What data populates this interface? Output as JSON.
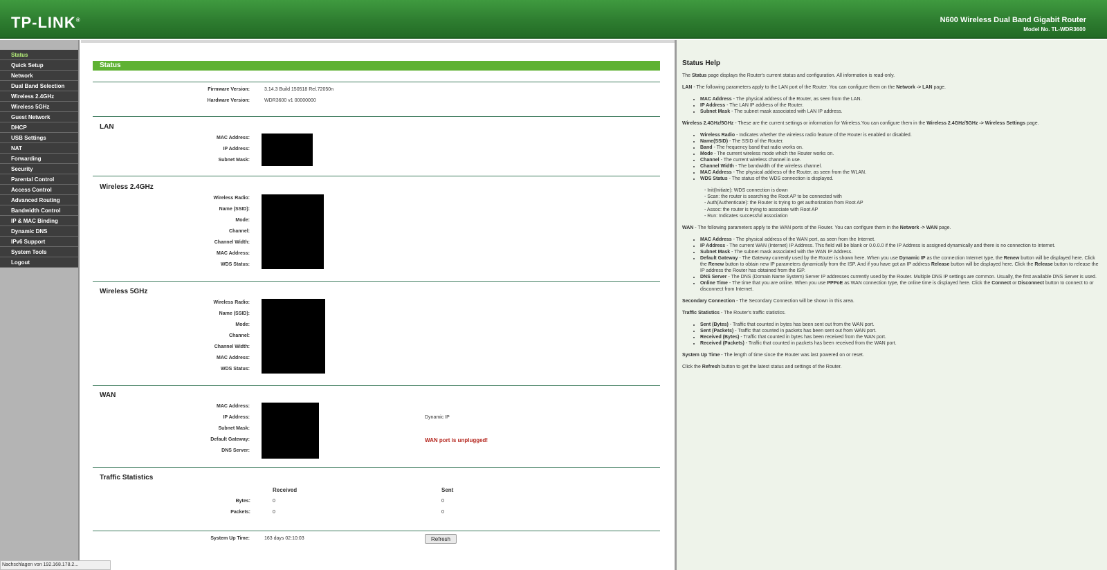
{
  "header": {
    "logo": "TP-LINK",
    "logo_mark": "®",
    "product": "N600 Wireless Dual Band Gigabit Router",
    "model": "Model No. TL-WDR3600"
  },
  "menu": [
    {
      "label": "Status",
      "active": true
    },
    {
      "label": "Quick Setup"
    },
    {
      "label": "Network"
    },
    {
      "label": "Dual Band Selection"
    },
    {
      "label": "Wireless 2.4GHz"
    },
    {
      "label": "Wireless 5GHz"
    },
    {
      "label": "Guest Network"
    },
    {
      "label": "DHCP"
    },
    {
      "label": "USB Settings"
    },
    {
      "label": "NAT"
    },
    {
      "label": "Forwarding"
    },
    {
      "label": "Security"
    },
    {
      "label": "Parental Control"
    },
    {
      "label": "Access Control"
    },
    {
      "label": "Advanced Routing"
    },
    {
      "label": "Bandwidth Control"
    },
    {
      "label": "IP & MAC Binding"
    },
    {
      "label": "Dynamic DNS"
    },
    {
      "label": "IPv6 Support"
    },
    {
      "label": "System Tools"
    },
    {
      "label": "Logout"
    }
  ],
  "status": {
    "title": "Status",
    "firmware_label": "Firmware Version:",
    "firmware_value": "3.14.3 Build 150518 Rel.72050n",
    "hardware_label": "Hardware Version:",
    "hardware_value": "WDR3600 v1 00000000",
    "lan": {
      "title": "LAN",
      "labels": [
        "MAC Address:",
        "IP Address:",
        "Subnet Mask:"
      ]
    },
    "w24": {
      "title": "Wireless 2.4GHz",
      "labels": [
        "Wireless Radio:",
        "Name (SSID):",
        "Mode:",
        "Channel:",
        "Channel Width:",
        "MAC Address:",
        "WDS Status:"
      ]
    },
    "w5": {
      "title": "Wireless 5GHz",
      "labels": [
        "Wireless Radio:",
        "Name (SSID):",
        "Mode:",
        "Channel:",
        "Channel Width:",
        "MAC Address:",
        "WDS Status:"
      ]
    },
    "wan": {
      "title": "WAN",
      "labels": [
        "MAC Address:",
        "IP Address:",
        "Subnet Mask:",
        "Default Gateway:",
        "DNS Server:"
      ],
      "ip_type": "Dynamic IP",
      "warning": "WAN port is unplugged!"
    },
    "traffic": {
      "title": "Traffic Statistics",
      "col_received": "Received",
      "col_sent": "Sent",
      "bytes_label": "Bytes:",
      "packets_label": "Packets:",
      "bytes_received": "0",
      "bytes_sent": "0",
      "packets_received": "0",
      "packets_sent": "0"
    },
    "uptime_label": "System Up Time:",
    "uptime_value": "163 days 02:10:03",
    "refresh_button": "Refresh"
  },
  "help": {
    "title": "Status Help"
  },
  "statusbar": "Nachschlagen von 192.168.178.2..."
}
